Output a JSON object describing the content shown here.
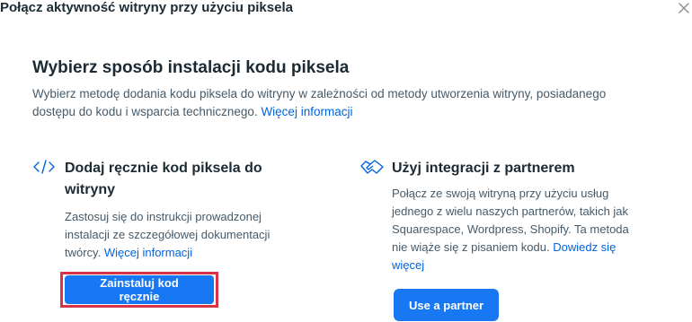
{
  "dialog": {
    "title": "Połącz aktywność witryny przy użyciu piksela",
    "close_icon": "close-icon"
  },
  "main": {
    "title": "Wybierz sposób instalacji kodu piksela",
    "description": "Wybierz metodę dodania kodu piksela do witryny w zależności od metody utworzenia witryny, posiadanego dostępu do kodu i wsparcia technicznego.",
    "learn_more": "Więcej informacji"
  },
  "options": {
    "manual": {
      "icon": "code-icon",
      "title": "Dodaj ręcznie kod piksela do witryny",
      "description": "Zastosuj się do instrukcji prowadzonej instalacji ze szczegółowej dokumentacji twórcy.",
      "link": "Więcej informacji",
      "button": "Zainstaluj kod ręcznie"
    },
    "partner": {
      "icon": "handshake-icon",
      "title": "Użyj integracji z partnerem",
      "description": "Połącz ze swoją witryną przy użyciu usług jednego z wielu naszych partnerów, takich jak Squarespace, Wordpress, Shopify. Ta metoda nie wiąże się z pisaniem kodu.",
      "link": "Dowiedz się więcej",
      "button": "Use a partner"
    }
  },
  "colors": {
    "primary_button": "#1877f2",
    "link": "#0064e0",
    "highlight": "#d93347"
  }
}
